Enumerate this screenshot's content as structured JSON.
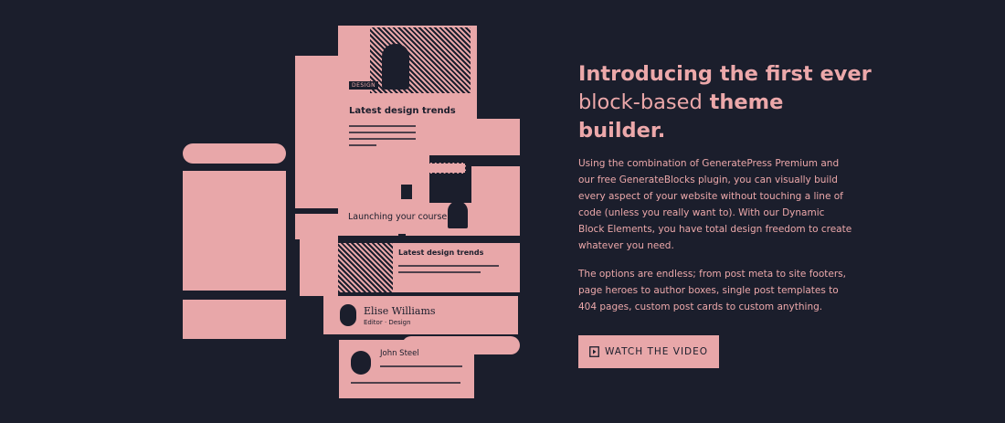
{
  "hero": {
    "headline": {
      "part1": "Introducing the first ever",
      "part2_light": "block-based",
      "part3": "theme",
      "part4": "builder."
    },
    "paragraph1": "Using the combination of GeneratePress Premium and our free GenerateBlocks plugin, you can visually build every aspect of your website without touching a line of code (unless you really want to). With our Dynamic Block Elements, you have total design freedom to create whatever you need.",
    "paragraph2": "The options are endless; from post meta to site footers, page heroes to author boxes, single post templates to 404 pages, custom post cards to custom anything.",
    "cta": {
      "label": "WATCH THE VIDEO",
      "icon": "play-video-icon"
    }
  },
  "illustration": {
    "top_card": {
      "tag": "DESIGN",
      "title": "Latest design trends"
    },
    "course_card": {
      "title": "Launching your course"
    },
    "small_post_card": {
      "title": "Latest design trends"
    },
    "author_box": {
      "name": "Elise Williams",
      "meta": "Editor · Design"
    },
    "comment": {
      "name": "John Steel"
    }
  },
  "colors": {
    "background": "#1b1e2c",
    "accent": "#e8a7a9"
  }
}
